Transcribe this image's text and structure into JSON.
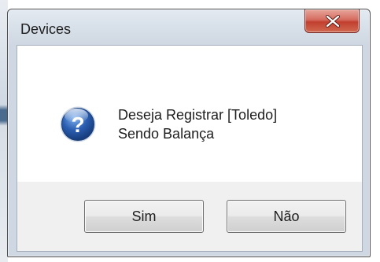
{
  "window": {
    "title": "Devices",
    "close_icon": "close-x-icon",
    "close_color": "#c23f2f"
  },
  "message": {
    "icon": "question-icon",
    "icon_color": "#2a5db0",
    "line1": "Deseja Registrar [Toledo]",
    "line2": "Sendo Balança"
  },
  "buttons": {
    "yes_label": "Sim",
    "no_label": "Não"
  }
}
